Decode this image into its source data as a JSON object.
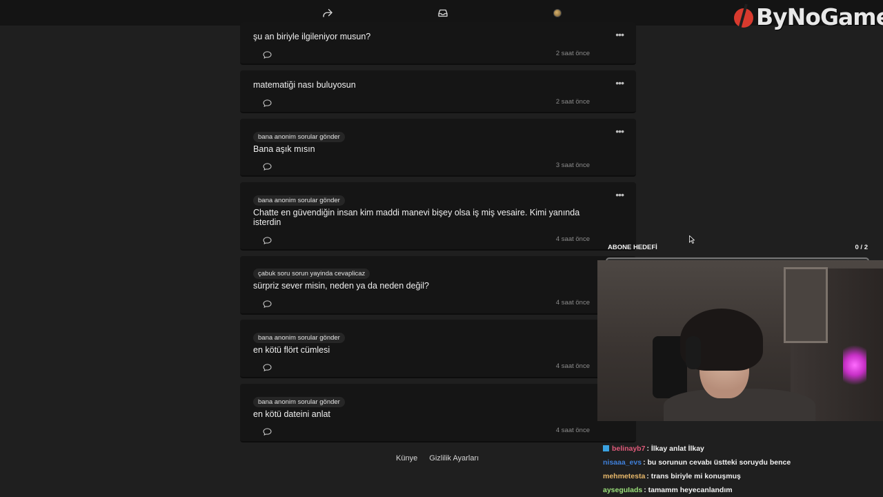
{
  "topbar": {
    "icons": [
      "share-icon",
      "inbox-icon",
      "avatar"
    ]
  },
  "watermark": {
    "text": "ByNoGame"
  },
  "questions": [
    {
      "tag": "",
      "text": "şu an biriyle ilgileniyor musun?",
      "time": "2 saat önce"
    },
    {
      "tag": "",
      "text": "matematiği nası buluyosun",
      "time": "2 saat önce"
    },
    {
      "tag": "bana anonim sorular gönder",
      "text": "Bana aşık mısın",
      "time": "3 saat önce"
    },
    {
      "tag": "bana anonim sorular gönder",
      "text": "Chatte en güvendiğin insan kim maddi manevi bişey olsa iş miş vesaire. Kimi yanında isterdin",
      "time": "4 saat önce"
    },
    {
      "tag": "çabuk soru sorun yayinda cevaplicaz",
      "text": "sürpriz sever misin, neden ya da neden değil?",
      "time": "4 saat önce"
    },
    {
      "tag": "bana anonim sorular gönder",
      "text": "en kötü flört cümlesi",
      "time": "4 saat önce"
    },
    {
      "tag": "bana anonim sorular gönder",
      "text": "en kötü dateini anlat",
      "time": "4 saat önce"
    }
  ],
  "footer": {
    "kunye": "Künye",
    "privacy": "Gizlilik Ayarları"
  },
  "goal": {
    "label": "ABONE HEDEFİ",
    "count": "0 / 2",
    "progress": 0
  },
  "chat": [
    {
      "user": "belinayb7",
      "color": "#e05a7a",
      "message": ": İlkay anlat İlkay",
      "badge": true
    },
    {
      "user": "nisaaa_evs",
      "color": "#3f7fd8",
      "message": ": bu sorunun cevabı üstteki soruydu bence",
      "badge": false
    },
    {
      "user": "mehmetesta",
      "color": "#e8b86a",
      "message": ": trans biriyle mi konuşmuş",
      "badge": false
    },
    {
      "user": "ayseguIads",
      "color": "#9be07a",
      "message": ": tamamm heyecanlandım",
      "badge": false
    }
  ]
}
